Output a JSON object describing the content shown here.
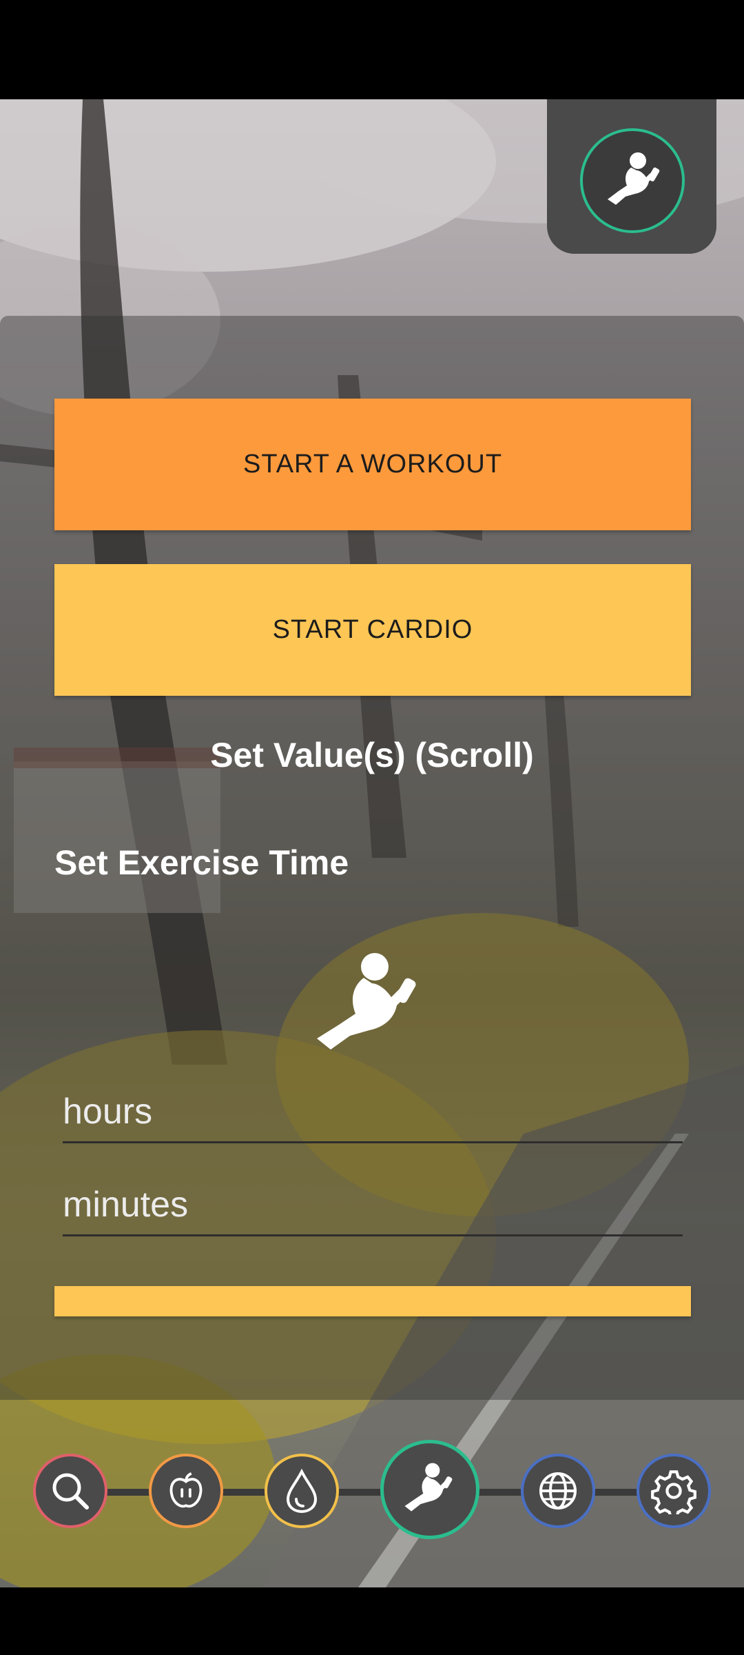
{
  "buttons": {
    "start_workout": "START A WORKOUT",
    "start_cardio": "START CARDIO",
    "bottom_submit": ""
  },
  "labels": {
    "set_values": "Set Value(s) (Scroll)",
    "set_exercise_time": "Set Exercise Time"
  },
  "inputs": {
    "hours_placeholder": "hours",
    "minutes_placeholder": "minutes"
  },
  "icons": {
    "top": "workout-icon",
    "center": "workout-icon",
    "nav": [
      "search-icon",
      "apple-icon",
      "water-drop-icon",
      "workout-icon",
      "globe-icon",
      "gear-icon"
    ]
  },
  "colors": {
    "workout_button": "#fd9a3c",
    "cardio_button": "#fdc655",
    "accent_green": "#2bbd8e",
    "search_ring": "#e0606a",
    "food_ring": "#f29a45",
    "water_ring": "#f2c04a",
    "globe_ring": "#4a6fc4",
    "settings_ring": "#4a6fc4"
  }
}
